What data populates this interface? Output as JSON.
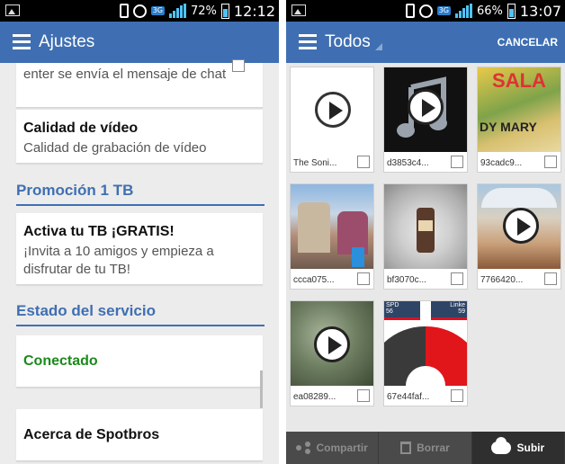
{
  "left": {
    "status": {
      "battery": "72%",
      "time": "12:12",
      "network": "3G"
    },
    "appbar": {
      "title": "Ajustes"
    },
    "items": {
      "partial_text": "enter se envía el mensaje de chat",
      "video_quality_title": "Calidad de vídeo",
      "video_quality_sub": "Calidad de grabación de vídeo",
      "section_promo": "Promoción 1 TB",
      "promo_title": "Activa tu TB ¡GRATIS!",
      "promo_sub": "¡Invita a 10 amigos y empieza a disfrutar de tu TB!",
      "section_service": "Estado del servicio",
      "connected": "Conectado",
      "about": "Acerca de Spotbros"
    },
    "colors": {
      "accent": "#3f6fb2",
      "connected": "#1a8a1a"
    }
  },
  "right": {
    "status": {
      "battery": "66%",
      "time": "13:07",
      "network": "3G"
    },
    "appbar": {
      "title": "Todos",
      "cancel": "CANCELAR"
    },
    "tiles": [
      {
        "label": "The Soni...",
        "icon": "play-icon"
      },
      {
        "label": "d3853c4...",
        "icon": "play-icon"
      },
      {
        "label": "93cadc9...",
        "icon": "none"
      },
      {
        "label": "ccca075...",
        "icon": "none"
      },
      {
        "label": "bf3070c...",
        "icon": "none"
      },
      {
        "label": "7766420...",
        "icon": "play-icon"
      },
      {
        "label": "ea08289...",
        "icon": "play-icon"
      },
      {
        "label": "67e44faf...",
        "icon": "none"
      }
    ],
    "thumb_texts": {
      "salad": "SALA",
      "mary": "DY MARY",
      "spd": "SPD",
      "linke": "Linke",
      "n56": "56",
      "n59": "59"
    },
    "bottombar": {
      "share": "Compartir",
      "delete": "Borrar",
      "upload": "Subir"
    }
  }
}
